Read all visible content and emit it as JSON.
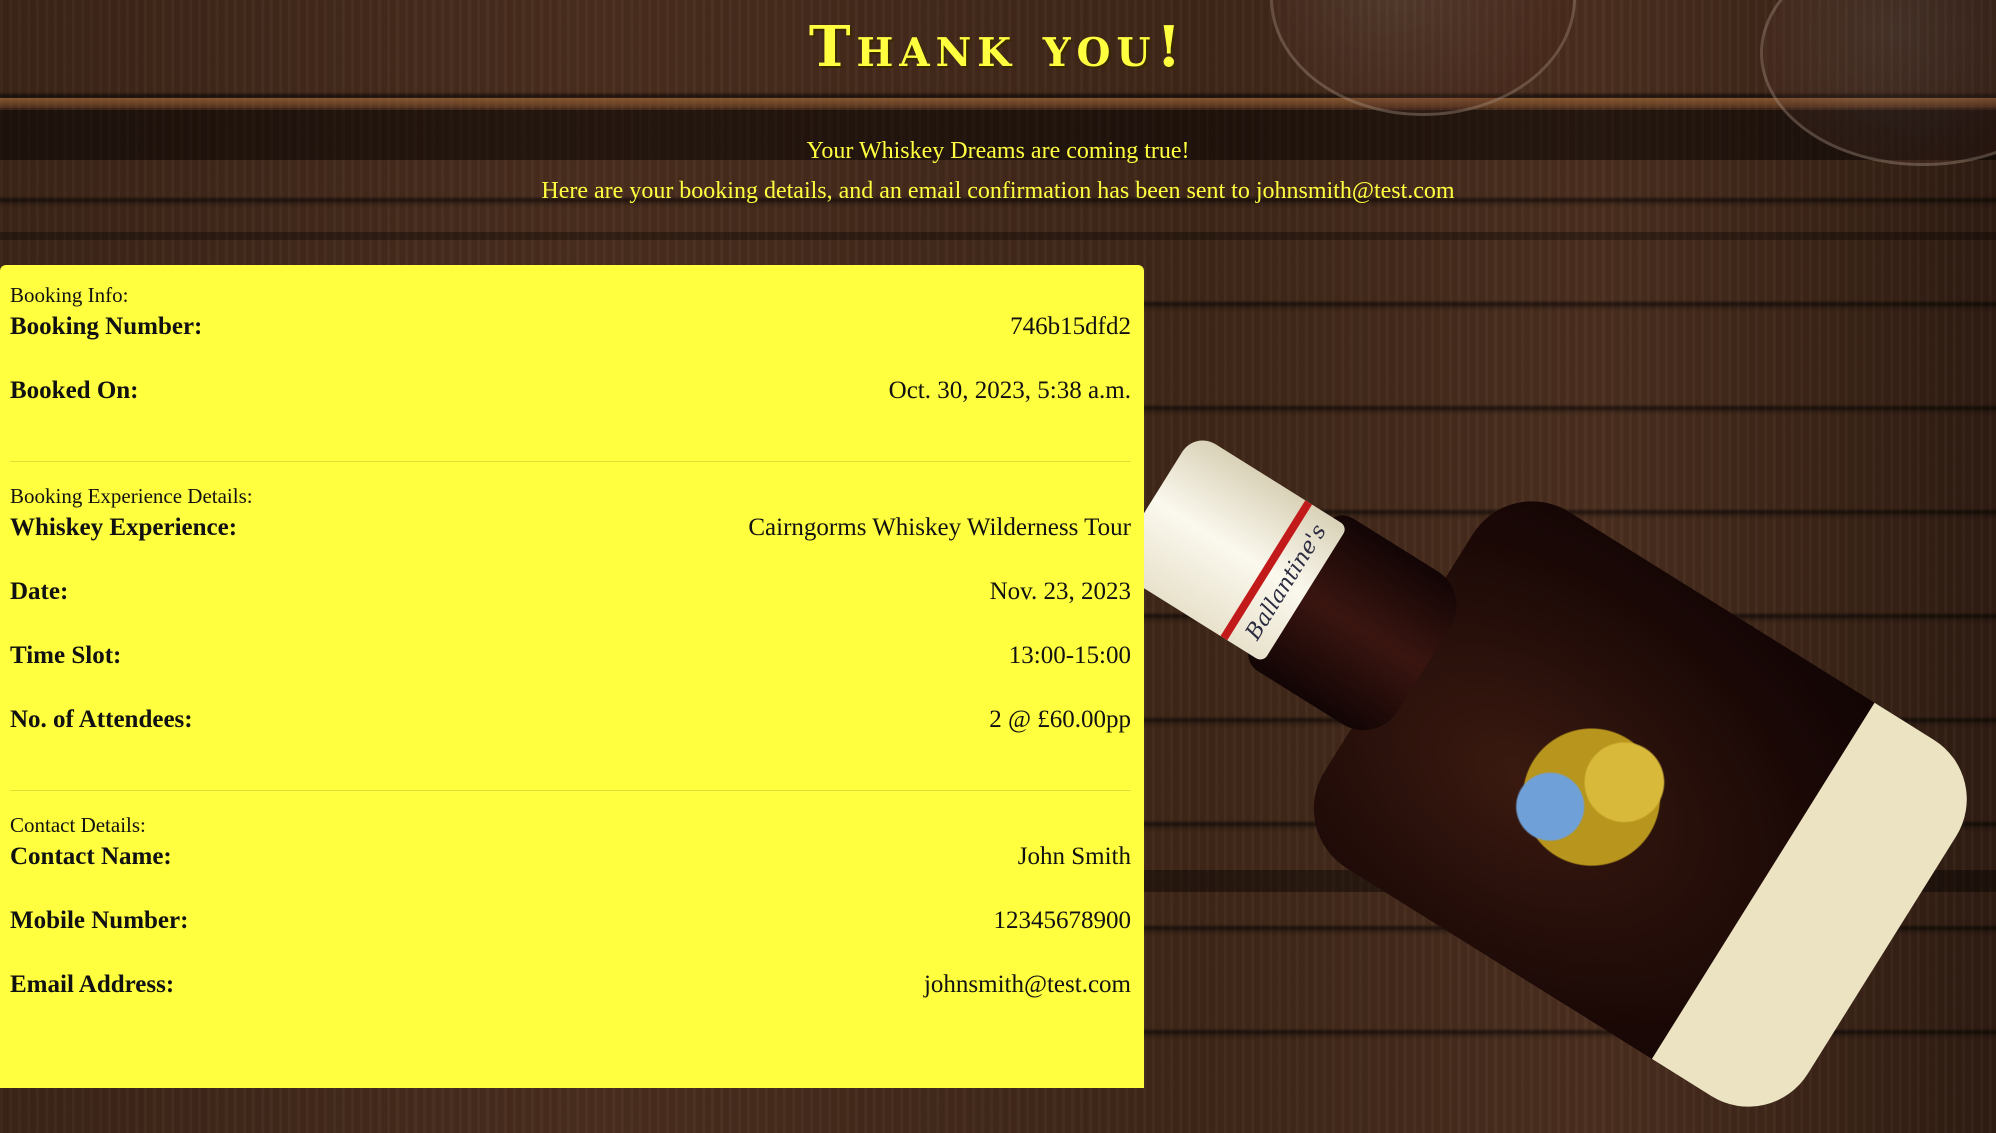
{
  "page": {
    "title": "Thank you!",
    "subtitle_line1": "Your Whiskey Dreams are coming true!",
    "subtitle_line2": "Here are your booking details, and an email confirmation has been sent to johnsmith@test.com"
  },
  "booking_info": {
    "section_label": "Booking Info:",
    "booking_number_label": "Booking Number:",
    "booking_number_value": "746b15dfd2",
    "booked_on_label": "Booked On:",
    "booked_on_value": "Oct. 30, 2023, 5:38 a.m."
  },
  "experience": {
    "section_label": "Booking Experience Details:",
    "experience_label": "Whiskey Experience:",
    "experience_value": "Cairngorms Whiskey Wilderness Tour",
    "date_label": "Date:",
    "date_value": "Nov. 23, 2023",
    "time_label": "Time Slot:",
    "time_value": "13:00-15:00",
    "attendees_label": "No. of Attendees:",
    "attendees_value": "2 @ £60.00pp"
  },
  "contact": {
    "section_label": "Contact Details:",
    "name_label": "Contact Name:",
    "name_value": "John Smith",
    "mobile_label": "Mobile Number:",
    "mobile_value": "12345678900",
    "email_label": "Email Address:",
    "email_value": "johnsmith@test.com"
  },
  "colors": {
    "accent": "#ffff40",
    "text": "#111111",
    "background_wood": "#3e2618"
  }
}
